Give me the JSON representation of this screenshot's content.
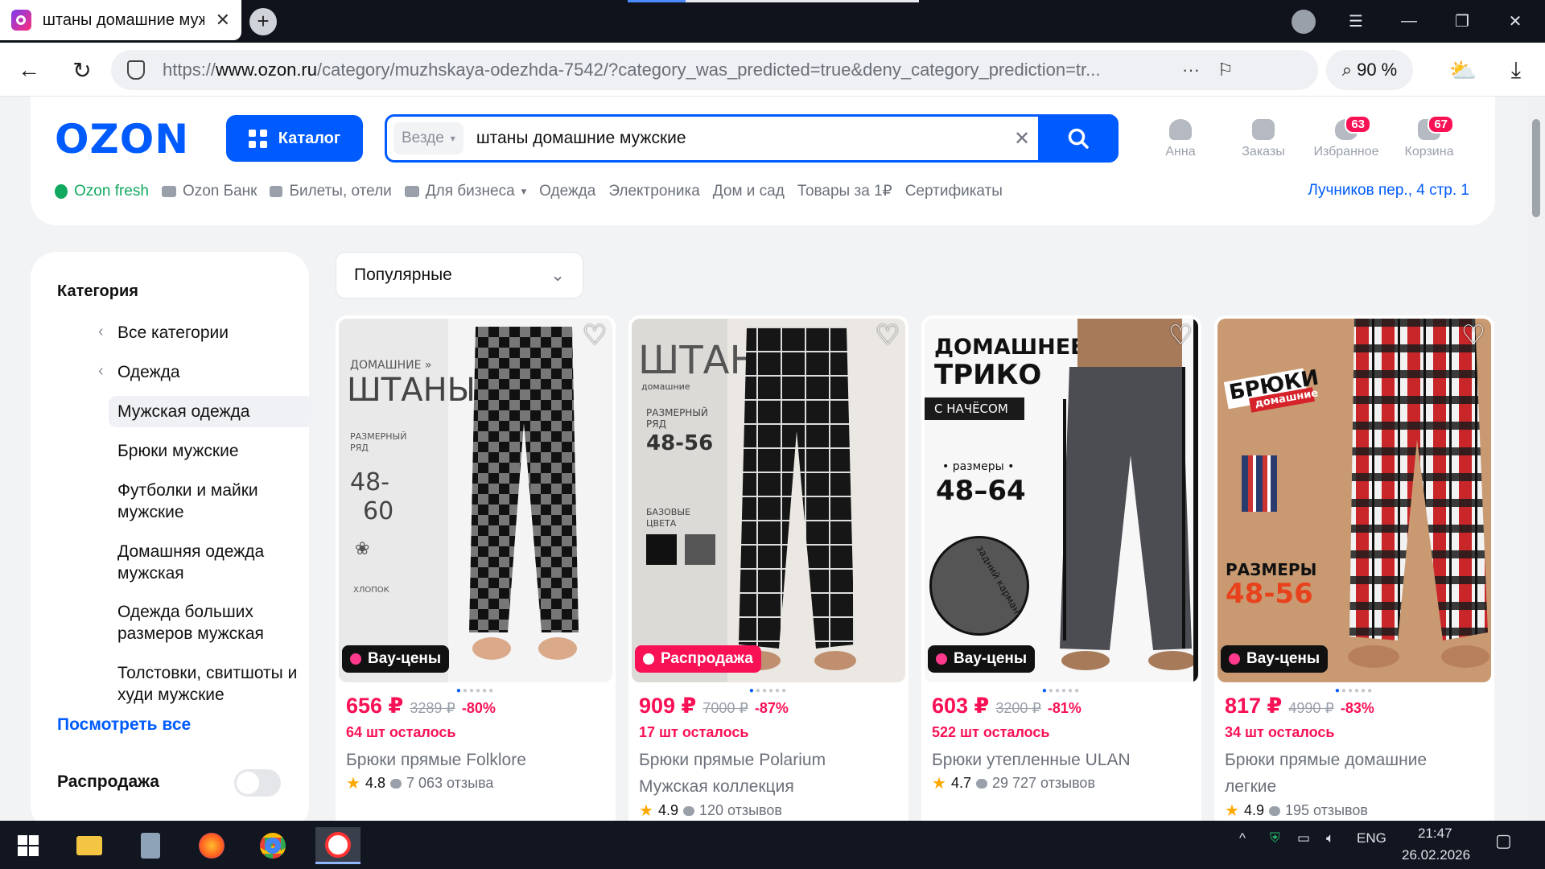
{
  "browser": {
    "tab_title": "штаны домашние мужские",
    "url_prefix": "https://",
    "url_host": "www.ozon.ru",
    "url_path": "/category/muzhskaya-odezhda-7542/?category_was_predicted=true&deny_category_prediction=tr...",
    "zoom": "90 %",
    "window_controls": [
      "menu-icon",
      "minimize-icon",
      "restore-icon",
      "close-icon"
    ]
  },
  "header": {
    "logo": "OZON",
    "catalog_label": "Каталог",
    "search_scope": "Везде",
    "search_query": "штаны домашние мужские",
    "icons": [
      {
        "label": "Анна",
        "badge": ""
      },
      {
        "label": "Заказы",
        "badge": ""
      },
      {
        "label": "Избранное",
        "badge": "63"
      },
      {
        "label": "Корзина",
        "badge": "67"
      }
    ],
    "links": [
      "Ozon fresh",
      "Ozon Банк",
      "Билеты, отели",
      "Для бизнеса",
      "Одежда",
      "Электроника",
      "Дом и сад",
      "Товары за 1₽",
      "Сертификаты"
    ],
    "address": "Лучников пер., 4 стр. 1"
  },
  "sidebar": {
    "heading": "Категория",
    "back_items": [
      "Все категории",
      "Одежда"
    ],
    "active_item": "Мужская одежда",
    "items": [
      "Брюки мужские",
      "Футболки и майки мужские",
      "Домашняя одежда мужская",
      "Одежда больших размеров мужская",
      "Толстовки, свитшоты и худи мужские"
    ],
    "see_all": "Посмотреть все",
    "sale_label": "Распродажа"
  },
  "sort": {
    "value": "Популярные"
  },
  "products": [
    {
      "tag": "Вау-цены",
      "tag_color": "#111111",
      "price": "656 ₽",
      "old_price": "3289 ₽",
      "discount": "-80%",
      "stock": "64 шт осталось",
      "title": "Брюки прямые Folklore",
      "rating": "4.8",
      "reviews": "7 063 отзыва",
      "img_text": [
        "ДОМАШНИЕ »",
        "ШТАНЫ",
        "РАЗМЕРНЫЙ",
        "РЯД",
        "48-",
        "60",
        "ХЛОПОК"
      ]
    },
    {
      "tag": "Распродажа",
      "tag_color": "#f91155",
      "price": "909 ₽",
      "old_price": "7000 ₽",
      "discount": "-87%",
      "stock": "17 шт осталось",
      "title": "Брюки прямые Polarium Мужская коллекция",
      "rating": "4.9",
      "reviews": "120 отзывов",
      "img_text": [
        "ШТАНЫ",
        "домашние",
        "РАЗМЕРНЫЙ",
        "РЯД",
        "48-56",
        "БАЗОВЫЕ",
        "ЦВЕТА"
      ]
    },
    {
      "tag": "Вау-цены",
      "tag_color": "#111111",
      "price": "603 ₽",
      "old_price": "3200 ₽",
      "discount": "-81%",
      "stock": "522 шт осталось",
      "title": "Брюки утепленные ULAN",
      "rating": "4.7",
      "reviews": "29 727 отзывов",
      "img_text": [
        "ДОМАШНЕЕ",
        "ТРИКО",
        "С НАЧЁСОМ",
        "• размеры •",
        "48–64",
        "задний карман"
      ]
    },
    {
      "tag": "Вау-цены",
      "tag_color": "#111111",
      "price": "817 ₽",
      "old_price": "4990 ₽",
      "discount": "-83%",
      "stock": "34 шт осталось",
      "title": "Брюки прямые домашние легкие",
      "rating": "4.9",
      "reviews": "195 отзывов",
      "img_text": [
        "БРЮКИ",
        "домашние",
        "РАЗМЕРЫ",
        "48-56"
      ]
    }
  ],
  "taskbar": {
    "lang": "ENG",
    "time": "21:47",
    "date": "26.02.2026"
  },
  "colors": {
    "brand": "#005bff",
    "accent": "#f91155",
    "star": "#ffa800"
  }
}
